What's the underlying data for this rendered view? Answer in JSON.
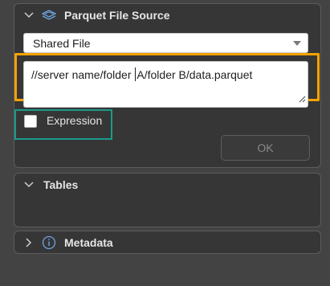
{
  "parquet_panel": {
    "title": "Parquet File Source",
    "chevron_icon": "chevron-down-icon",
    "source_icon": "parquet-layers-icon",
    "source_select": {
      "value": "Shared File"
    },
    "path_input": {
      "before_caret": "//server name/folder ",
      "after_caret": "A/folder B/data.parquet"
    },
    "expression_label": "Expression",
    "expression_checked": false,
    "ok_label": "OK",
    "highlight_colors": {
      "path": "#f5a300",
      "expression": "#1a9b8a"
    }
  },
  "tables_panel": {
    "title": "Tables",
    "chevron_icon": "chevron-down-icon"
  },
  "metadata_panel": {
    "title": "Metadata",
    "chevron_icon": "chevron-right-icon",
    "info_icon": "info-icon"
  }
}
